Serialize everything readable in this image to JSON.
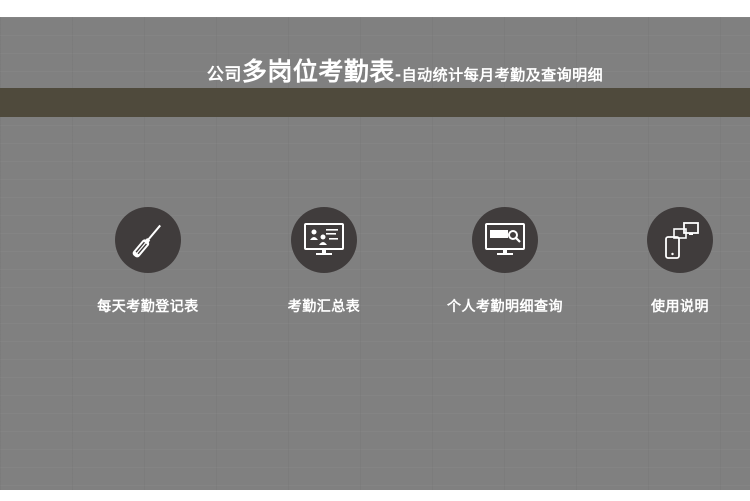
{
  "header": {
    "title_prefix": "公司",
    "title_main": "多岗位考勤表",
    "title_suffix": "-自动统计每月考勤及查询明细"
  },
  "tiles": [
    {
      "label": "每天考勤登记表",
      "icon": "screwdriver-icon"
    },
    {
      "label": "考勤汇总表",
      "icon": "monitor-users-icon"
    },
    {
      "label": "个人考勤明细查询",
      "icon": "monitor-search-icon"
    },
    {
      "label": "使用说明",
      "icon": "devices-icon"
    }
  ],
  "colors": {
    "background": "#808080",
    "band": "#4f4a3c",
    "icon_circle": "#403c3c",
    "text": "#ffffff"
  }
}
